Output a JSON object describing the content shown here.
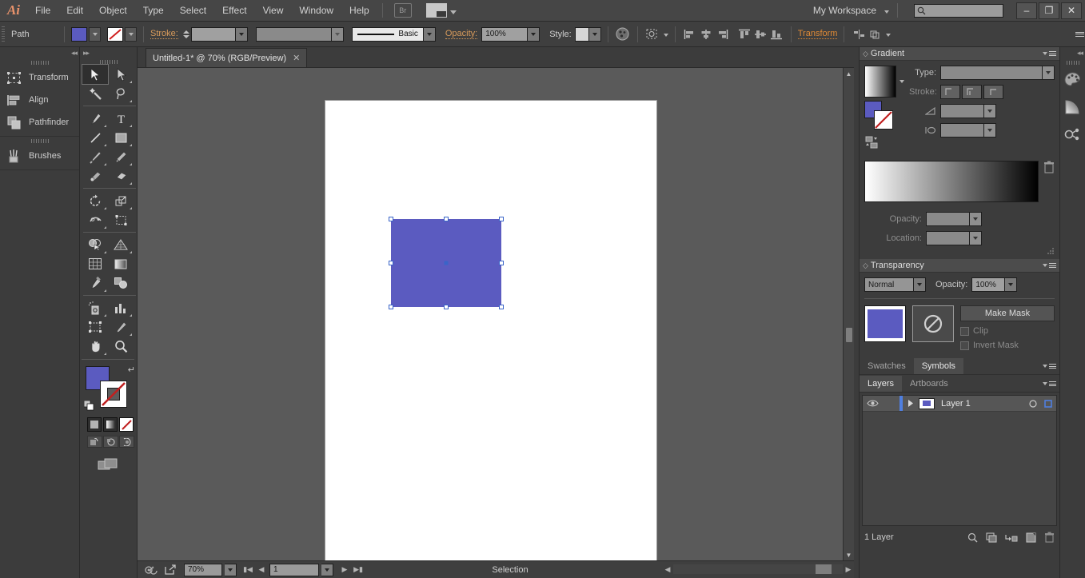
{
  "app": {
    "name": "Adobe Illustrator",
    "logo_text": "Ai"
  },
  "menubar": {
    "items": [
      "File",
      "Edit",
      "Object",
      "Type",
      "Select",
      "Effect",
      "View",
      "Window",
      "Help"
    ],
    "bridge_label": "Br",
    "workspace_label": "My Workspace",
    "search_value": "",
    "search_placeholder": "",
    "window_minimize": "–",
    "window_restore": "❐",
    "window_close": "✕"
  },
  "controlbar": {
    "object_label": "Path",
    "fill_color": "#5b5bc0",
    "stroke_label": "Stroke:",
    "stroke_weight_value": "",
    "stroke_profile_value": "",
    "brush_label": "Basic",
    "opacity_label": "Opacity:",
    "opacity_value": "100%",
    "style_label": "Style:",
    "transform_link": "Transform"
  },
  "leftdock": {
    "groups": [
      {
        "items": [
          {
            "label": "Transform",
            "icon": "transform-icon"
          },
          {
            "label": "Align",
            "icon": "align-icon"
          },
          {
            "label": "Pathfinder",
            "icon": "pathfinder-icon"
          }
        ]
      },
      {
        "items": [
          {
            "label": "Brushes",
            "icon": "brushes-icon"
          }
        ]
      }
    ]
  },
  "toolbar": {
    "active_tool": "Selection",
    "tools": [
      "selection-tool",
      "direct-selection-tool",
      "magic-wand-tool",
      "lasso-tool",
      "pen-tool",
      "type-tool",
      "line-segment-tool",
      "rectangle-tool",
      "paintbrush-tool",
      "pencil-tool",
      "blob-brush-tool",
      "eraser-tool",
      "rotate-tool",
      "scale-tool",
      "width-tool",
      "free-transform-tool",
      "shape-builder-tool",
      "perspective-grid-tool",
      "mesh-tool",
      "gradient-tool",
      "eyedropper-tool",
      "blend-tool",
      "symbol-sprayer-tool",
      "column-graph-tool",
      "artboard-tool",
      "slice-tool",
      "hand-tool",
      "zoom-tool"
    ],
    "fill_color": "#5b5bc0",
    "stroke_color": "none"
  },
  "document": {
    "tab_title": "Untitled-1* @ 70% (RGB/Preview)",
    "close_label": "✕",
    "shape_fill": "#5b5bc0",
    "selection_color": "#3a64c8"
  },
  "statusbar": {
    "zoom_value": "70%",
    "artboard_value": "1",
    "status_text": "Selection"
  },
  "gradient_panel": {
    "title": "Gradient",
    "type_label": "Type:",
    "type_value": "",
    "stroke_label": "Stroke:",
    "angle_value": "",
    "aspect_value": "",
    "opacity_label": "Opacity:",
    "opacity_value": "",
    "location_label": "Location:",
    "location_value": "",
    "gradient_start": "#ffffff",
    "gradient_end": "#000000"
  },
  "transparency_panel": {
    "title": "Transparency",
    "blend_mode": "Normal",
    "opacity_label": "Opacity:",
    "opacity_value": "100%",
    "make_mask_label": "Make Mask",
    "clip_label": "Clip",
    "invert_mask_label": "Invert Mask",
    "thumb_color": "#5b5bc0"
  },
  "symbols_panel": {
    "tabs": [
      {
        "label": "Swatches",
        "active": false
      },
      {
        "label": "Symbols",
        "active": true
      }
    ]
  },
  "layers_panel": {
    "tabs": [
      {
        "label": "Layers",
        "active": true
      },
      {
        "label": "Artboards",
        "active": false
      }
    ],
    "layers": [
      {
        "name": "Layer 1",
        "visible": true,
        "locked": false,
        "color": "#4f7fe0",
        "selected": true
      }
    ],
    "footer_count": "1 Layer"
  },
  "fardock": {
    "icons": [
      "color-icon",
      "gradient-icon",
      "symbols-icon"
    ]
  }
}
